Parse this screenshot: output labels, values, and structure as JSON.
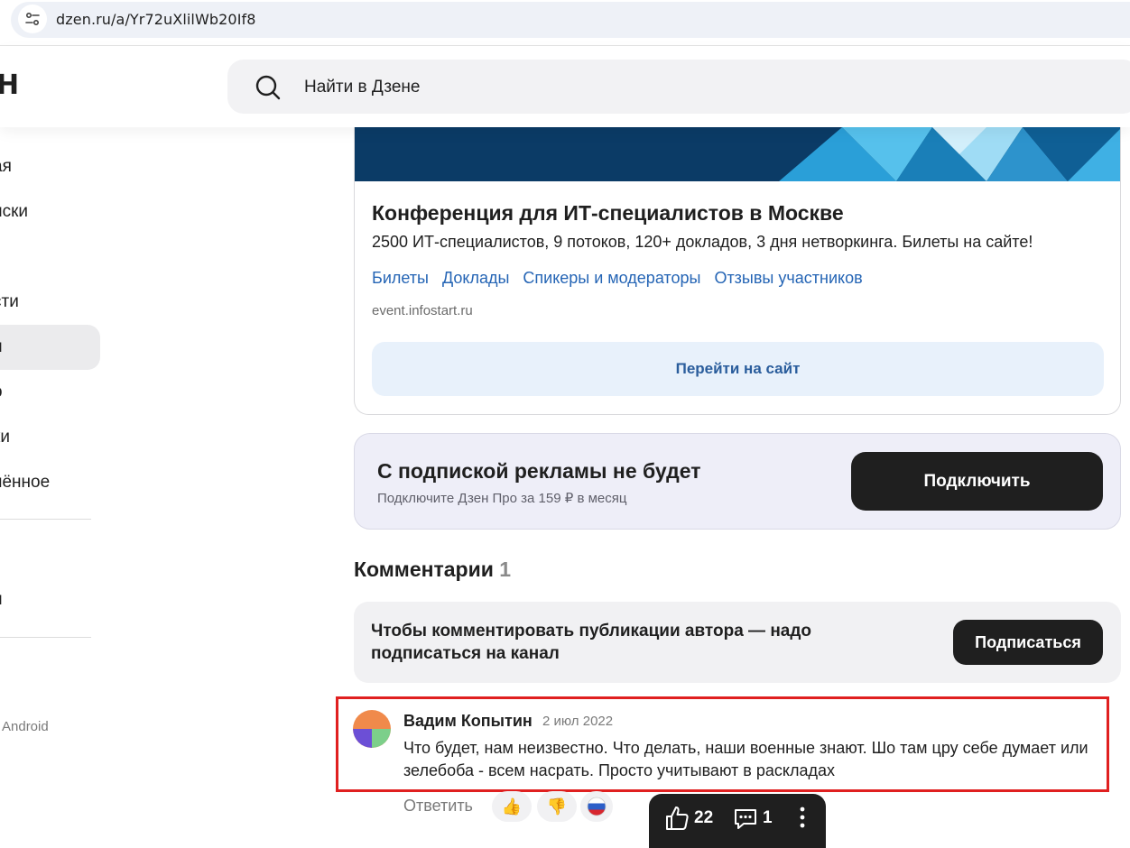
{
  "browser": {
    "url": "dzen.ru/a/Yr72uXlilWb20If8"
  },
  "header": {
    "logo": "Н",
    "search_placeholder": "Найти в Дзене"
  },
  "sidebar": {
    "items": [
      {
        "label": "ая"
      },
      {
        "label": "иски"
      },
      {
        "label": "і"
      },
      {
        "label": "сти"
      },
      {
        "label": "и"
      },
      {
        "label": "о"
      },
      {
        "label": "ки"
      },
      {
        "label": "нённое"
      },
      {
        "label": "и"
      }
    ],
    "footer": "Android"
  },
  "ad": {
    "title": "Конференция для ИТ-специалистов в Москве",
    "description": "2500 ИТ-специалистов, 9 потоков, 120+ докладов, 3 дня нетворкинга. Билеты на сайте!",
    "links": [
      "Билеты",
      "Доклады",
      "Спикеры и модераторы",
      "Отзывы участников"
    ],
    "domain": "event.infostart.ru",
    "button": "Перейти на сайт"
  },
  "promo": {
    "title": "С подпиской рекламы не будет",
    "subtitle": "Подключите Дзен Про за 159 ₽ в месяц",
    "button": "Подключить"
  },
  "comments": {
    "title": "Комментарии",
    "count": "1",
    "subscribe_text": "Чтобы комментировать публикации автора — надо подписаться на канал",
    "subscribe_button": "Подписаться",
    "items": [
      {
        "author": "Вадим Копытин",
        "date": "2 июл 2022",
        "text": "Что будет, нам неизвестно. Что делать, наши военные знают. Шо там цру себе думает или зелебоба - всем насрать. Просто учитывают в раскладах",
        "reply_label": "Ответить",
        "reactions": [
          "👍",
          "👎",
          "🇷🇺"
        ]
      }
    ]
  },
  "action_bar": {
    "likes": "22",
    "comments": "1"
  }
}
